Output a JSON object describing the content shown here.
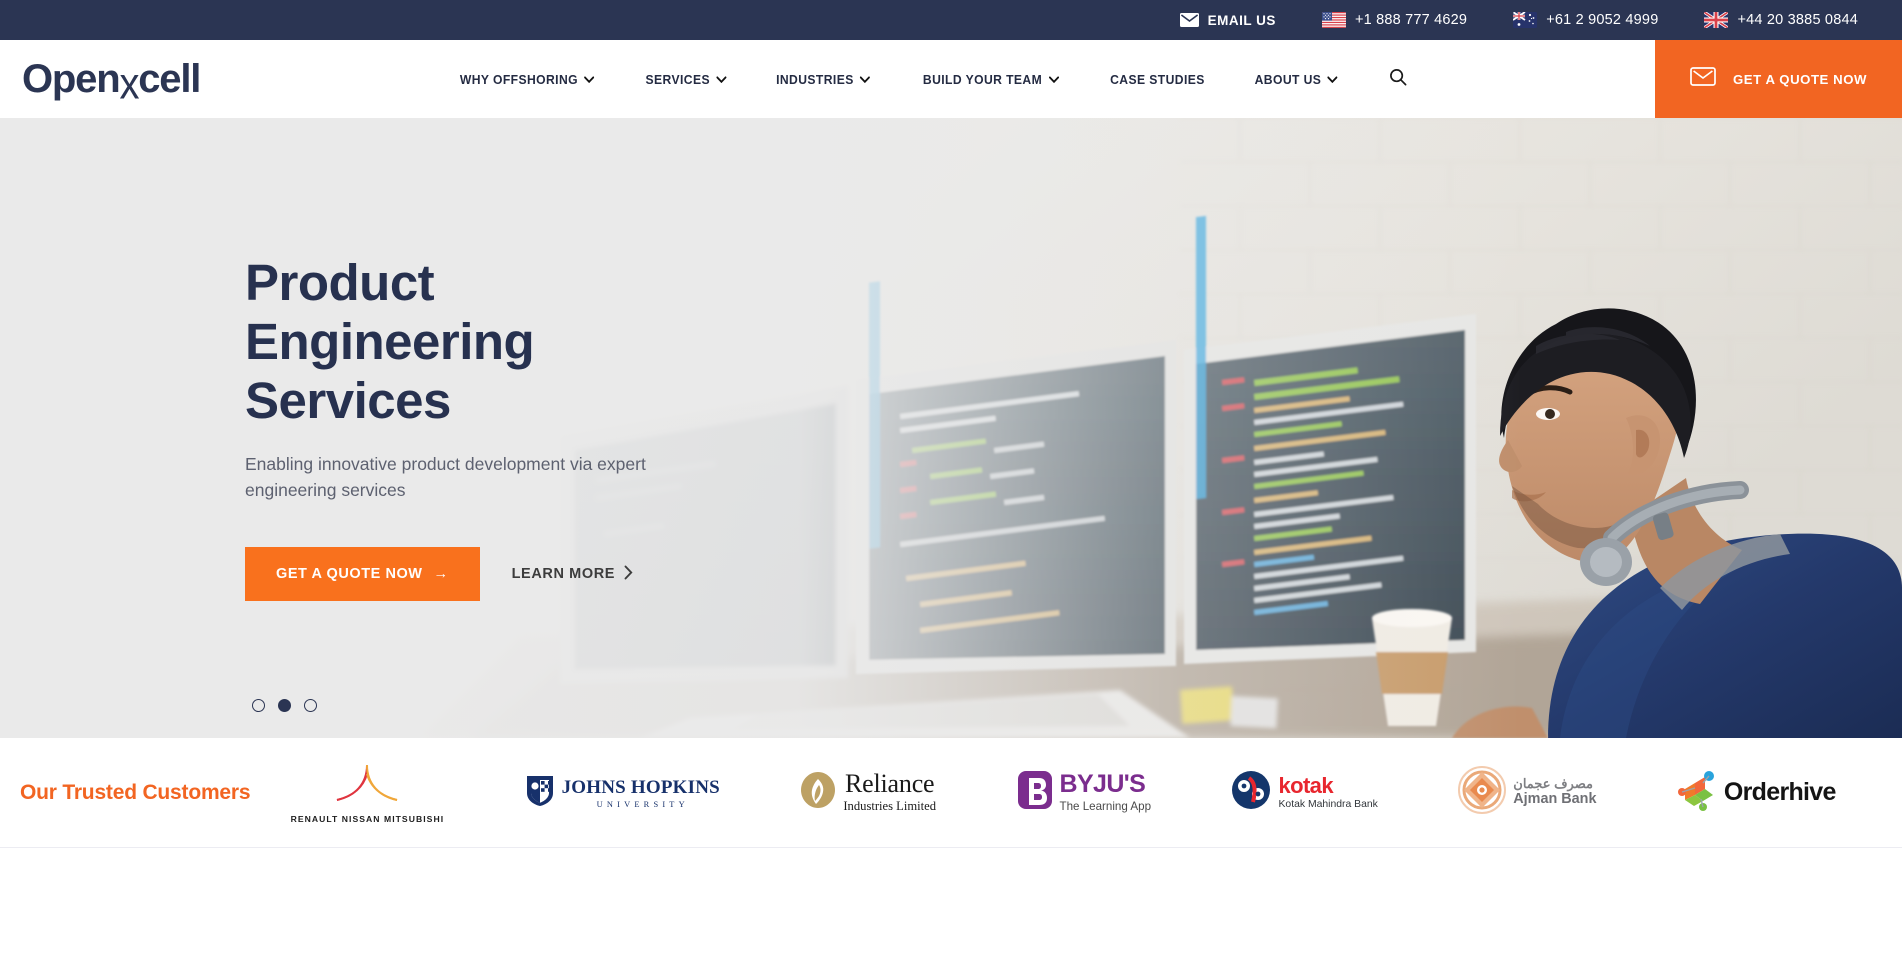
{
  "topbar": {
    "email_label": "EMAIL US",
    "email_icon": "envelope-icon",
    "phones": [
      {
        "flag": "flag-us",
        "number": "+1 888 777 4629"
      },
      {
        "flag": "flag-au",
        "number": "+61 2 9052 4999"
      },
      {
        "flag": "flag-uk",
        "number": "+44 20 3885 0844"
      }
    ],
    "bg_color": "#2b3553"
  },
  "header": {
    "logo_text_a": "Openx",
    "logo_text_x": "x",
    "logo_pre": "Open",
    "logo_post": "cell",
    "nav": [
      {
        "label": "WHY OFFSHORING",
        "caret": true
      },
      {
        "label": "SERVICES",
        "caret": true
      },
      {
        "label": "INDUSTRIES",
        "caret": true
      },
      {
        "label": "BUILD YOUR TEAM",
        "caret": true
      },
      {
        "label": "CASE STUDIES",
        "caret": false
      },
      {
        "label": "ABOUT US",
        "caret": true
      }
    ],
    "search_icon": "search-icon",
    "cta_label": "GET A QUOTE NOW",
    "cta_icon": "envelope-outline-icon",
    "cta_color": "#f26522"
  },
  "hero": {
    "title": "Product Engineering Services",
    "subtitle": "Enabling innovative product development via expert engineering services",
    "primary_button": "GET A QUOTE NOW",
    "primary_arrow": "→",
    "secondary_button": "LEARN MORE",
    "secondary_arrow": "›",
    "dots_total": 3,
    "dots_active_index": 1,
    "accent_color": "#f9711d",
    "title_color": "#27314f"
  },
  "trusted": {
    "title": "Our Trusted Customers",
    "title_color": "#f26522",
    "logos": [
      {
        "name": "renault-nissan-mitsubishi",
        "caption": "RENAULT NISSAN MITSUBISHI"
      },
      {
        "name": "johns-hopkins-university",
        "main": "JOHNS HOPKINS",
        "sub": "UNIVERSITY"
      },
      {
        "name": "reliance-industries-limited",
        "main": "Reliance",
        "sub": "Industries Limited"
      },
      {
        "name": "byjus",
        "main": "BYJU'S",
        "sub": "The Learning App"
      },
      {
        "name": "kotak-mahindra-bank",
        "main": "kotak",
        "sub": "Kotak Mahindra Bank"
      },
      {
        "name": "ajman-bank",
        "arabic": "مصرف عجمان",
        "english": "Ajman Bank"
      },
      {
        "name": "orderhive",
        "main": "Orderhive"
      }
    ]
  }
}
